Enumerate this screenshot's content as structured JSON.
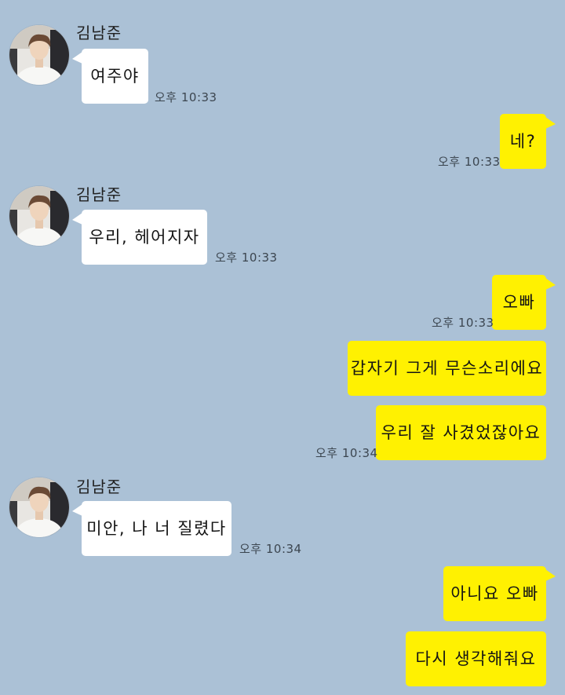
{
  "colors": {
    "background": "#abc1d6",
    "incoming_bubble": "#ffffff",
    "outgoing_bubble": "#fff101",
    "text": "#141414",
    "time_text": "#3c4650"
  },
  "icons": {
    "avatar": "profile-photo-icon"
  },
  "chat": {
    "sender_name": "김남준",
    "messages": [
      {
        "direction": "in",
        "show_sender": true,
        "text": "여주야",
        "time": "오후 10:33"
      },
      {
        "direction": "out",
        "show_sender": false,
        "text": "네?",
        "time": "오후 10:33"
      },
      {
        "direction": "in",
        "show_sender": true,
        "text": "우리, 헤어지자",
        "time": "오후 10:33"
      },
      {
        "direction": "out",
        "show_sender": false,
        "text": "오빠",
        "time": "오후 10:33"
      },
      {
        "direction": "out",
        "show_sender": false,
        "text": "갑자기 그게 무슨소리에요",
        "time": ""
      },
      {
        "direction": "out",
        "show_sender": false,
        "text": "우리 잘 사겼었잖아요",
        "time": "오후 10:34"
      },
      {
        "direction": "in",
        "show_sender": true,
        "text": "미안, 나 너 질렸다",
        "time": "오후 10:34"
      },
      {
        "direction": "out",
        "show_sender": false,
        "text": "아니요 오빠",
        "time": ""
      },
      {
        "direction": "out",
        "show_sender": false,
        "text": "다시 생각해줘요",
        "time": ""
      }
    ]
  }
}
